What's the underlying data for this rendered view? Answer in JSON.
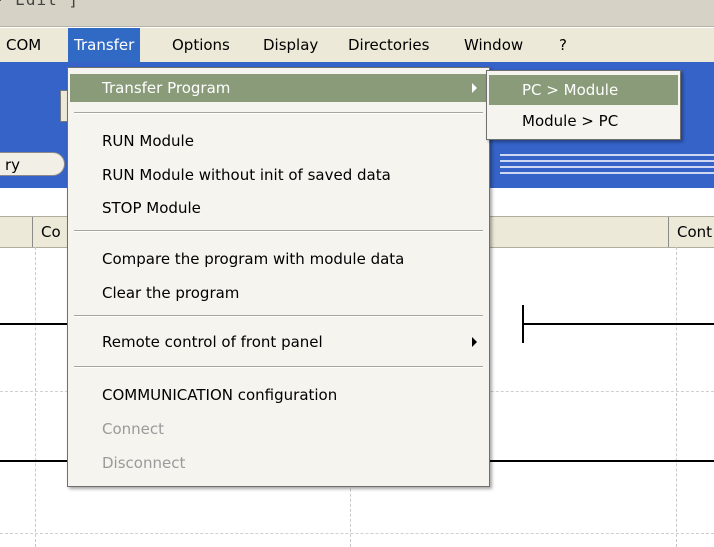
{
  "title_fragment": "- Edit ]",
  "menubar": {
    "items": [
      "COM",
      "Transfer",
      "Options",
      "Display",
      "Directories",
      "Window",
      "?"
    ]
  },
  "background": {
    "pill_label": "ry",
    "header_cells": [
      "Co",
      "Cont"
    ]
  },
  "transfer_menu": {
    "items": [
      {
        "label": "Transfer Program",
        "submenu": true,
        "highlighted": true
      },
      {
        "label": "RUN Module"
      },
      {
        "label": "RUN Module without init of saved data"
      },
      {
        "label": "STOP Module"
      },
      {
        "label": "Compare the program with module data"
      },
      {
        "label": "Clear the program"
      },
      {
        "label": "Remote control of front panel",
        "submenu": true
      },
      {
        "label": "COMMUNICATION configuration"
      },
      {
        "label": "Connect",
        "disabled": true
      },
      {
        "label": "Disconnect",
        "disabled": true
      }
    ]
  },
  "transfer_program_submenu": {
    "items": [
      {
        "label": "PC > Module",
        "highlighted": true
      },
      {
        "label": "Module > PC"
      }
    ]
  },
  "colors": {
    "menu_highlight": "#8a9b7a",
    "toolbar_blue": "#3563c8",
    "menubar_active": "#316ac5"
  }
}
